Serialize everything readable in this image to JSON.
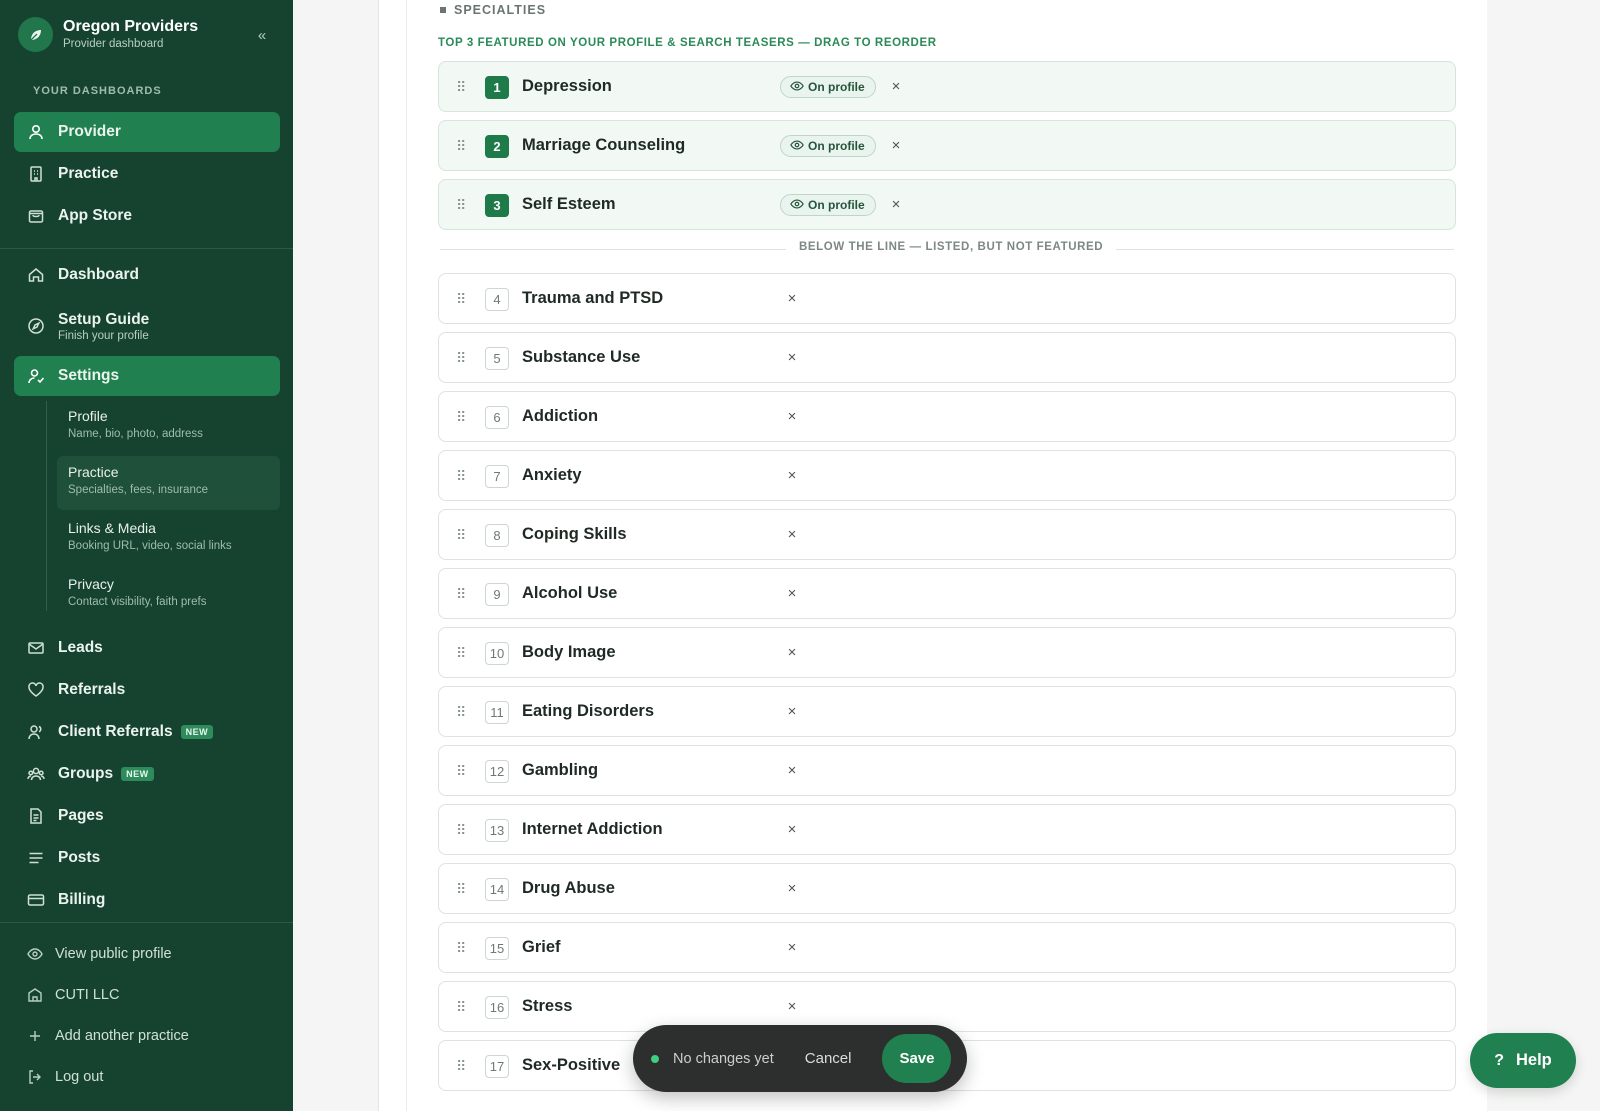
{
  "brand": {
    "title": "Oregon Providers",
    "subtitle": "Provider dashboard"
  },
  "sidebar": {
    "section_label": "YOUR DASHBOARDS",
    "dashboards": [
      {
        "label": "Provider",
        "icon": "user-icon",
        "active": true
      },
      {
        "label": "Practice",
        "icon": "building-icon",
        "active": false
      },
      {
        "label": "App Store",
        "icon": "store-icon",
        "active": false
      }
    ],
    "nav": [
      {
        "label": "Dashboard",
        "icon": "home-icon"
      },
      {
        "label": "Setup Guide",
        "sub": "Finish your profile",
        "icon": "compass-icon"
      },
      {
        "label": "Settings",
        "icon": "user-settings-icon",
        "active": true
      }
    ],
    "settings_sub": [
      {
        "title": "Profile",
        "desc": "Name, bio, photo, address"
      },
      {
        "title": "Practice",
        "desc": "Specialties, fees, insurance",
        "active": true
      },
      {
        "title": "Links & Media",
        "desc": "Booking URL, video, social links"
      },
      {
        "title": "Privacy",
        "desc": "Contact visibility, faith prefs"
      }
    ],
    "more": [
      {
        "label": "Leads",
        "icon": "mail-icon"
      },
      {
        "label": "Referrals",
        "icon": "heart-icon"
      },
      {
        "label": "Client Referrals",
        "icon": "users-icon",
        "badge": "NEW"
      },
      {
        "label": "Groups",
        "icon": "group-icon",
        "badge": "NEW"
      },
      {
        "label": "Pages",
        "icon": "page-icon"
      },
      {
        "label": "Posts",
        "icon": "list-icon"
      },
      {
        "label": "Billing",
        "icon": "card-icon"
      }
    ],
    "footer": [
      {
        "label": "View public profile",
        "icon": "eye-icon"
      },
      {
        "label": "CUTI LLC",
        "icon": "practice-icon"
      },
      {
        "label": "Add another practice",
        "icon": "plus-icon"
      },
      {
        "label": "Log out",
        "icon": "logout-icon"
      }
    ]
  },
  "specialties": {
    "header": "SPECIALTIES",
    "top_label": "TOP 3 FEATURED ON YOUR PROFILE & SEARCH TEASERS — DRAG TO REORDER",
    "pill_label": "On profile",
    "line_label": "BELOW THE LINE — LISTED, BUT NOT FEATURED",
    "featured": [
      {
        "num": "1",
        "name": "Depression"
      },
      {
        "num": "2",
        "name": "Marriage Counseling"
      },
      {
        "num": "3",
        "name": "Self Esteem"
      }
    ],
    "listed": [
      {
        "num": "4",
        "name": "Trauma and PTSD"
      },
      {
        "num": "5",
        "name": "Substance Use"
      },
      {
        "num": "6",
        "name": "Addiction"
      },
      {
        "num": "7",
        "name": "Anxiety"
      },
      {
        "num": "8",
        "name": "Coping Skills"
      },
      {
        "num": "9",
        "name": "Alcohol Use"
      },
      {
        "num": "10",
        "name": "Body Image"
      },
      {
        "num": "11",
        "name": "Eating Disorders"
      },
      {
        "num": "12",
        "name": "Gambling"
      },
      {
        "num": "13",
        "name": "Internet Addiction"
      },
      {
        "num": "14",
        "name": "Drug Abuse"
      },
      {
        "num": "15",
        "name": "Grief"
      },
      {
        "num": "16",
        "name": "Stress"
      },
      {
        "num": "17",
        "name": "Sex-Positive"
      }
    ]
  },
  "save_bar": {
    "status": "No changes yet",
    "cancel": "Cancel",
    "save": "Save"
  },
  "help": {
    "label": "Help"
  },
  "colors": {
    "sidebar_bg": "#16432f",
    "accent": "#21804f",
    "featured_bg": "#f2f8f4"
  }
}
